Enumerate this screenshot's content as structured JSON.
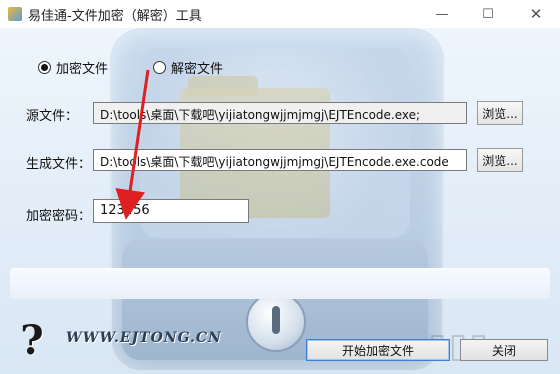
{
  "window": {
    "title": "易佳通-文件加密（解密）工具",
    "controls": {
      "minimize": "—",
      "maximize": "☐",
      "close": "✕"
    }
  },
  "mode": {
    "encrypt_label": "加密文件",
    "decrypt_label": "解密文件",
    "selected": "encrypt"
  },
  "form": {
    "source_label": "源文件：",
    "source_value": "D:\\tools\\桌面\\下载吧\\yijiatongwjjmjmgj\\EJTEncode.exe;",
    "output_label": "生成文件：",
    "output_value": "D:\\tools\\桌面\\下载吧\\yijiatongwjjmjmgj\\EJTEncode.exe.code",
    "password_label": "加密密码：",
    "password_value": "123456",
    "browse_label": "浏览..."
  },
  "footer": {
    "help_glyph": "?",
    "site": "WWW.EJTONG.CN",
    "start_button": "开始加密文件",
    "close_button": "关闭"
  },
  "colors": {
    "accent_arrow": "#e02020",
    "primary_border": "#3b7fd6"
  }
}
